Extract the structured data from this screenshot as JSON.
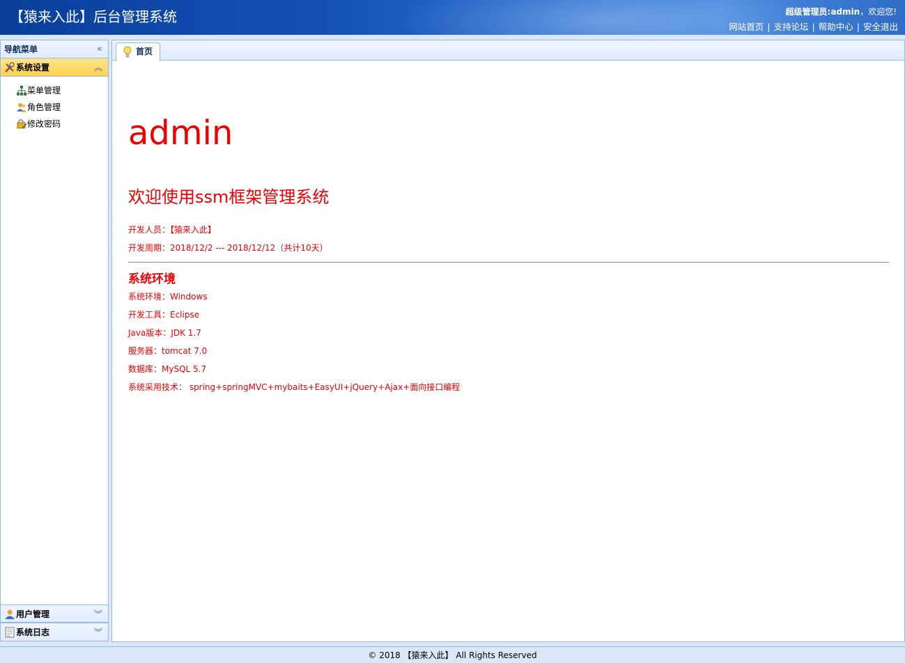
{
  "header": {
    "title": "【猿来入此】后台管理系统",
    "role_label": "超级管理员:admin",
    "welcome_suffix": "，欢迎您!",
    "links": [
      "网站首页",
      "支持论坛",
      "帮助中心",
      "安全退出"
    ]
  },
  "sidebar": {
    "title": "导航菜单",
    "sections": [
      {
        "label": "系统设置",
        "icon": "tools-icon",
        "expanded": true,
        "items": [
          {
            "label": "菜单管理",
            "icon": "sitemap-icon"
          },
          {
            "label": "角色管理",
            "icon": "users-icon"
          },
          {
            "label": "修改密码",
            "icon": "lock-edit-icon"
          }
        ]
      },
      {
        "label": "用户管理",
        "icon": "user-icon",
        "expanded": false
      },
      {
        "label": "系统日志",
        "icon": "log-icon",
        "expanded": false
      }
    ]
  },
  "tabs": [
    {
      "label": "首页",
      "icon": "lightbulb-icon"
    }
  ],
  "content": {
    "username": "admin",
    "welcome": "欢迎使用ssm框架管理系统",
    "developer": "开发人员：【猿来入此】",
    "period": "开发周期：2018/12/2 --- 2018/12/12（共计10天）",
    "env_title": "系统环境",
    "env": [
      "系统环境：Windows",
      "开发工具：Eclipse",
      "Java版本：JDK 1.7",
      "服务器：tomcat 7.0",
      "数据库：MySQL 5.7",
      "系统采用技术： spring+springMVC+mybaits+EasyUI+jQuery+Ajax+面向接口编程"
    ]
  },
  "footer": "© 2018 【猿来入此】 All Rights Reserved",
  "colors": {
    "accent": "#e00000",
    "header": "#1450b4",
    "border": "#95b8e7",
    "active_section": "#ffd24a"
  }
}
